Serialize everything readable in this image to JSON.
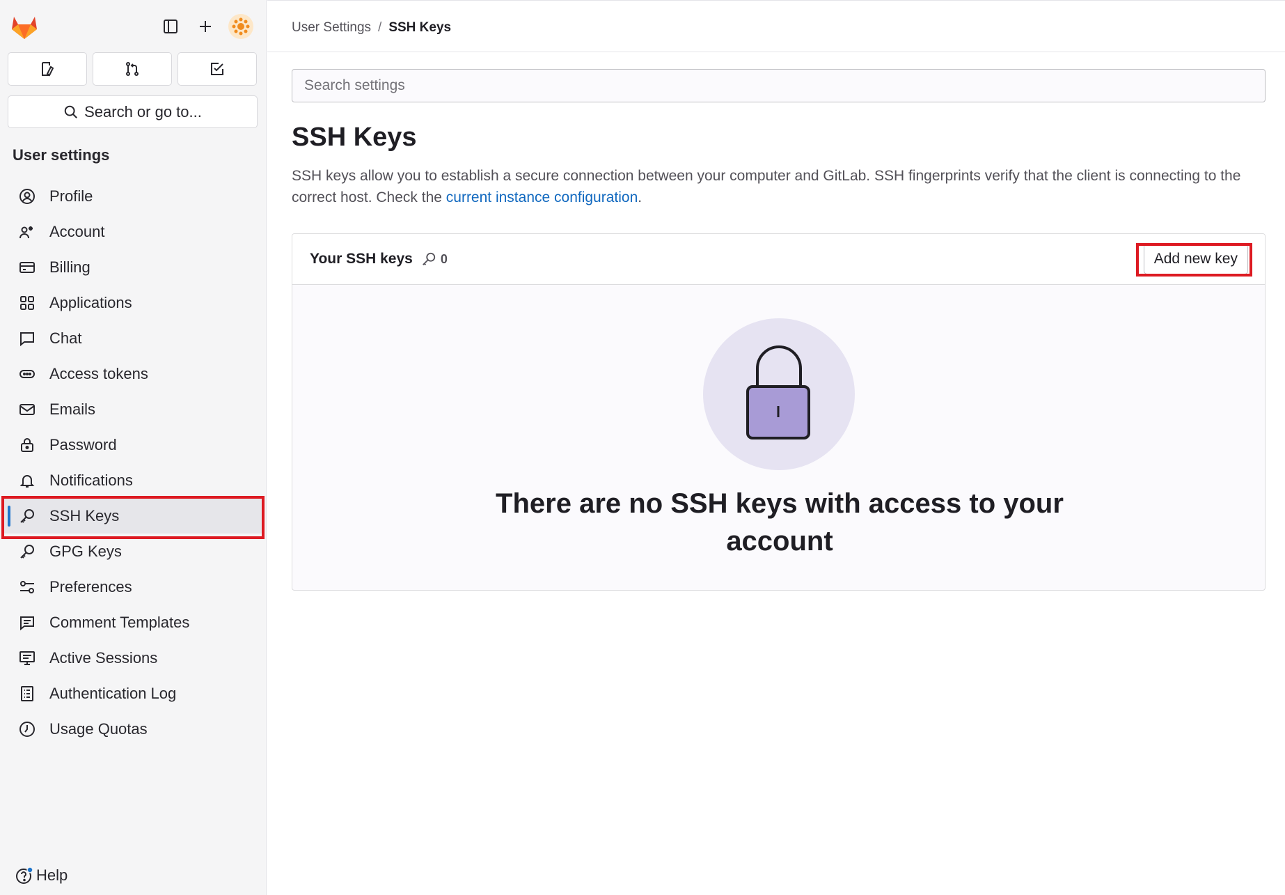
{
  "sidebar": {
    "search_label": "Search or go to...",
    "section_title": "User settings",
    "items": [
      {
        "label": "Profile",
        "icon": "profile-icon"
      },
      {
        "label": "Account",
        "icon": "account-icon"
      },
      {
        "label": "Billing",
        "icon": "billing-icon"
      },
      {
        "label": "Applications",
        "icon": "applications-icon"
      },
      {
        "label": "Chat",
        "icon": "chat-icon"
      },
      {
        "label": "Access tokens",
        "icon": "token-icon"
      },
      {
        "label": "Emails",
        "icon": "mail-icon"
      },
      {
        "label": "Password",
        "icon": "lock-icon"
      },
      {
        "label": "Notifications",
        "icon": "bell-icon"
      },
      {
        "label": "SSH Keys",
        "icon": "key-icon",
        "active": true
      },
      {
        "label": "GPG Keys",
        "icon": "key-icon"
      },
      {
        "label": "Preferences",
        "icon": "preferences-icon"
      },
      {
        "label": "Comment Templates",
        "icon": "comment-icon"
      },
      {
        "label": "Active Sessions",
        "icon": "monitor-icon"
      },
      {
        "label": "Authentication Log",
        "icon": "log-icon"
      },
      {
        "label": "Usage Quotas",
        "icon": "quota-icon"
      }
    ],
    "help_label": "Help"
  },
  "breadcrumb": {
    "parent": "User Settings",
    "separator": "/",
    "current": "SSH Keys"
  },
  "search": {
    "placeholder": "Search settings"
  },
  "page": {
    "title": "SSH Keys",
    "description_prefix": "SSH keys allow you to establish a secure connection between your computer and GitLab. SSH fingerprints verify that the client is connecting to the correct host. Check the ",
    "description_link": "current instance configuration",
    "description_suffix": "."
  },
  "card": {
    "title": "Your SSH keys",
    "count": "0",
    "add_button": "Add new key",
    "empty_state": "There are no SSH keys with access to your account"
  },
  "colors": {
    "accent": "#1f75cb",
    "link": "#1068bf",
    "highlight": "#dd1a22",
    "lock_fill": "#a89bd6"
  }
}
